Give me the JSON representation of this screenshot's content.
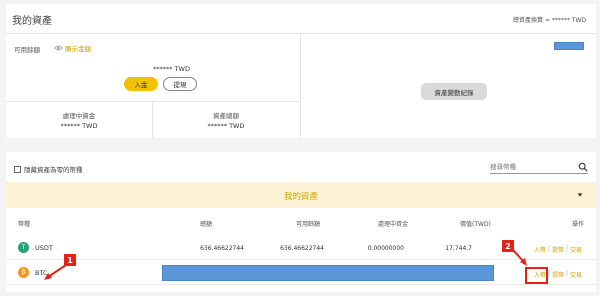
{
  "header": {
    "title": "我的資產",
    "total_label": "總資產換算 ≈ ****** TWD"
  },
  "summary": {
    "available_label": "可用餘額",
    "show_amount_label": "顯示金額",
    "available_value": "****** TWD",
    "deposit_label": "入金",
    "withdraw_label": "提現",
    "processing_label": "處理中資金",
    "processing_value": "****** TWD",
    "total_assets_label": "資產總額",
    "total_assets_value": "****** TWD",
    "history_label": "資產變動紀錄"
  },
  "filters": {
    "hide_zero_label": "隱藏資產為零的幣種",
    "search_placeholder": "搜尋幣種"
  },
  "assets": {
    "section_title": "我的資產",
    "columns": [
      "幣種",
      "總額",
      "可用餘額",
      "處理中資金",
      "價值(TWD)",
      "操作"
    ],
    "rows": [
      {
        "coin": "USDT",
        "total": "636.46622744",
        "available": "636.46622744",
        "processing": "0.00000000",
        "value": "17,744.7",
        "ops": [
          "入幣",
          "提幣",
          "交易"
        ]
      },
      {
        "coin": "BTC",
        "ops": [
          "入幣",
          "提幣",
          "交易"
        ]
      }
    ]
  },
  "colors": {
    "accent": "#f2c200",
    "accent_text": "#d4a000",
    "usdt": "#26a17b",
    "btc": "#f7931a",
    "mask_blue": "#5b97d6",
    "annotation": "#e62117"
  }
}
